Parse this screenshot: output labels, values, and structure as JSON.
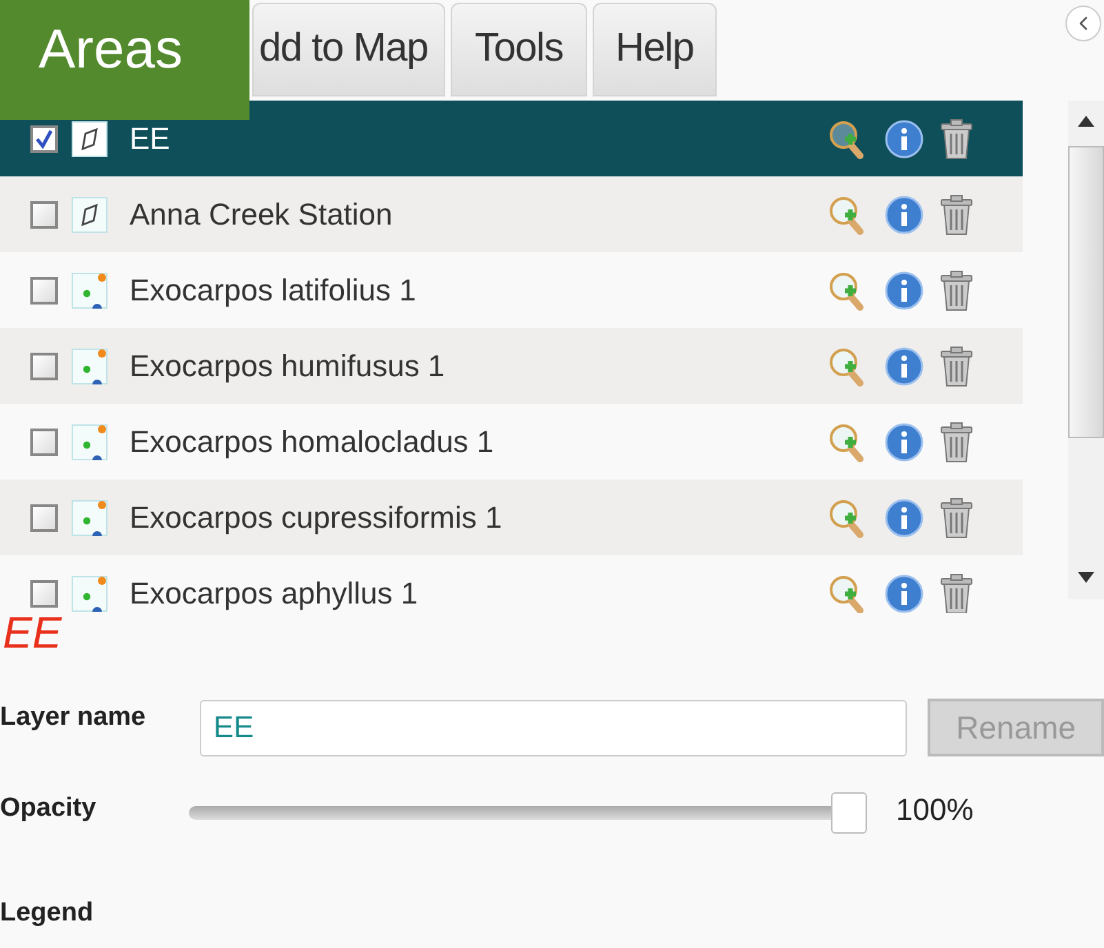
{
  "overlay_label": "Areas",
  "tabs": [
    {
      "label": "dd to Map",
      "selected": false
    },
    {
      "label": "Tools",
      "selected": false
    },
    {
      "label": "Help",
      "selected": false
    }
  ],
  "layers": [
    {
      "kind": "area",
      "name": "EE",
      "checked": true,
      "selected": true
    },
    {
      "kind": "area",
      "name": "Anna Creek Station",
      "checked": false,
      "selected": false
    },
    {
      "kind": "species",
      "name": "Exocarpos latifolius 1",
      "checked": false,
      "selected": false
    },
    {
      "kind": "species",
      "name": "Exocarpos humifusus 1",
      "checked": false,
      "selected": false
    },
    {
      "kind": "species",
      "name": "Exocarpos homalocladus 1",
      "checked": false,
      "selected": false
    },
    {
      "kind": "species",
      "name": "Exocarpos cupressiformis 1",
      "checked": false,
      "selected": false
    },
    {
      "kind": "species",
      "name": "Exocarpos aphyllus 1",
      "checked": false,
      "selected": false
    }
  ],
  "detail": {
    "title": "EE",
    "layer_name_label": "Layer name",
    "layer_name_value": "EE",
    "rename_button": "Rename",
    "rename_disabled": true,
    "opacity_label": "Opacity",
    "opacity": {
      "level": 1,
      "reading": "100%"
    },
    "legend_label": "Legend"
  }
}
